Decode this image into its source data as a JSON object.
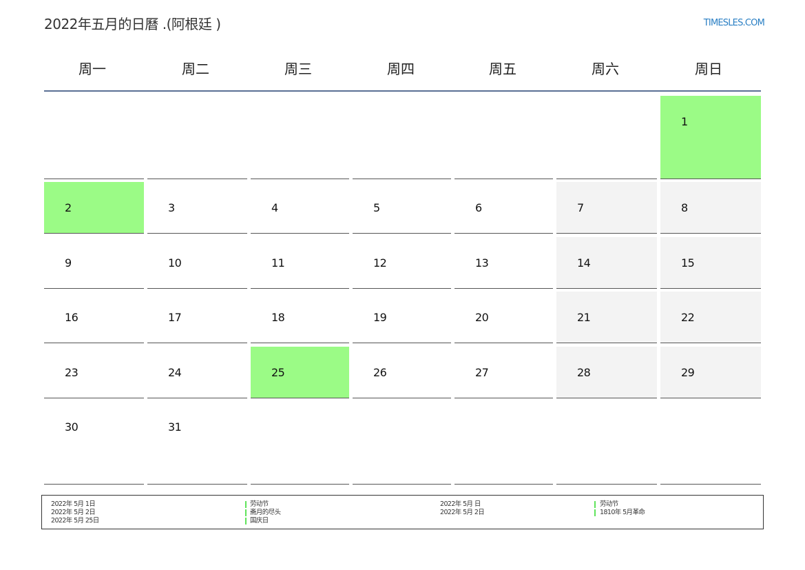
{
  "header": {
    "title": "2022年五月的日曆 .(阿根廷 )",
    "site": "TIMESLES.COM"
  },
  "weekdays": [
    "周一",
    "周二",
    "周三",
    "周四",
    "周五",
    "周六",
    "周日"
  ],
  "calendar": {
    "weeks": [
      [
        "",
        "",
        "",
        "",
        "",
        "",
        "1"
      ],
      [
        "2",
        "3",
        "4",
        "5",
        "6",
        "7",
        "8"
      ],
      [
        "9",
        "10",
        "11",
        "12",
        "13",
        "14",
        "15"
      ],
      [
        "16",
        "17",
        "18",
        "19",
        "20",
        "21",
        "22"
      ],
      [
        "23",
        "24",
        "25",
        "26",
        "27",
        "28",
        "29"
      ],
      [
        "30",
        "31",
        "",
        "",
        "",
        "",
        ""
      ]
    ],
    "holidays": [
      "1",
      "2",
      "25"
    ],
    "colors": {
      "holiday": "#9bfb86",
      "weekend": "#f3f3f3",
      "header_line": "#5a6f94",
      "site_link": "#2a7fc4"
    }
  },
  "legend": {
    "left": [
      {
        "date": "2022年 5月 1日",
        "name": "劳动节"
      },
      {
        "date": "2022年 5月 2日",
        "name": "斋月的尽头"
      },
      {
        "date": "2022年 5月 25日",
        "name": "国庆日"
      }
    ],
    "right": [
      {
        "date": "2022年 5月 日",
        "name": "劳动节"
      },
      {
        "date": "2022年 5月 2日",
        "name": "1810年 5月革命"
      }
    ]
  }
}
